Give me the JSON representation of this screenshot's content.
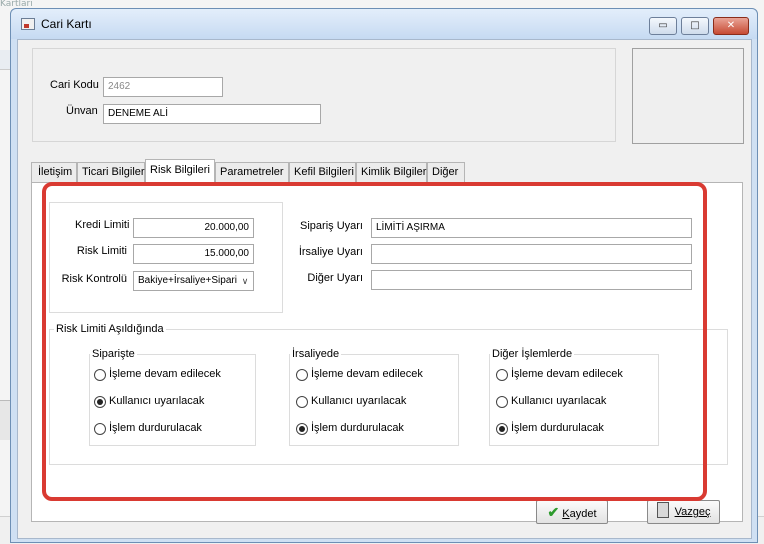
{
  "background_app": {
    "title_fragment": "Kartları"
  },
  "window": {
    "title": "Cari Kartı",
    "min_icon": "▭",
    "max_icon": "□",
    "close_icon": "✕"
  },
  "header": {
    "cari_kodu_label": "Cari Kodu",
    "cari_kodu_value": "2462",
    "unvan_label": "Ünvan",
    "unvan_value": "DENEME ALİ"
  },
  "tabs": [
    {
      "label": "İletişim"
    },
    {
      "label": "Ticari Bilgiler"
    },
    {
      "label": "Risk Bilgileri",
      "active": true
    },
    {
      "label": "Parametreler"
    },
    {
      "label": "Kefil Bilgileri"
    },
    {
      "label": "Kimlik Bilgileri"
    },
    {
      "label": "Diğer"
    }
  ],
  "risk": {
    "kredi_limiti_label": "Kredi Limiti",
    "kredi_limiti_value": "20.000,00",
    "risk_limiti_label": "Risk Limiti",
    "risk_limiti_value": "15.000,00",
    "risk_kontrolu_label": "Risk Kontrolü",
    "risk_kontrolu_value": "Bakiye+İrsaliye+Sipariş",
    "siparis_uyari_label": "Sipariş Uyarı",
    "siparis_uyari_value": "LİMİTİ AŞIRMA",
    "irsaliye_uyari_label": "İrsaliye Uyarı",
    "irsaliye_uyari_value": "",
    "diger_uyari_label": "Diğer Uyarı",
    "diger_uyari_value": ""
  },
  "exceed": {
    "title": "Risk Limiti Aşıldığında",
    "groups": [
      {
        "title": "Siparişte",
        "options": [
          "İşleme devam edilecek",
          "Kullanıcı uyarılacak",
          "İşlem durdurulacak"
        ],
        "selected": 1
      },
      {
        "title": "İrsaliyede",
        "options": [
          "İşleme devam edilecek",
          "Kullanıcı uyarılacak",
          "İşlem durdurulacak"
        ],
        "selected": 2
      },
      {
        "title": "Diğer İşlemlerde",
        "options": [
          "İşleme devam edilecek",
          "Kullanıcı uyarılacak",
          "İşlem durdurulacak"
        ],
        "selected": 2
      }
    ]
  },
  "buttons": {
    "save_key": "K",
    "save_rest": "aydet",
    "cancel_key": "V",
    "cancel_rest": "azgeç"
  },
  "colors": {
    "highlight": "#d93a32",
    "save_icon": "#2e9b2e"
  }
}
